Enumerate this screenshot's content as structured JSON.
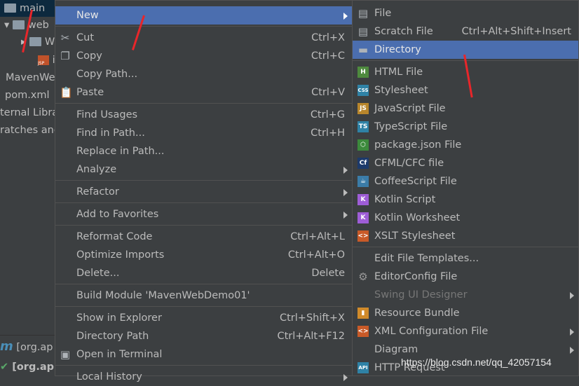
{
  "project_tree": {
    "items": [
      "main",
      "web",
      "W",
      "i",
      "MavenWe",
      "pom.xml",
      "ternal Libra",
      "ratches and"
    ],
    "bottom": [
      "[org.ap",
      "[org.ap"
    ]
  },
  "main_menu": [
    {
      "label": "New",
      "submenu": true,
      "highlighted": true
    },
    {
      "sep": true
    },
    {
      "label": "Cut",
      "shortcut": "Ctrl+X",
      "icon": "scissors-icon"
    },
    {
      "label": "Copy",
      "shortcut": "Ctrl+C",
      "icon": "copy-icon"
    },
    {
      "label": "Copy Path..."
    },
    {
      "label": "Paste",
      "shortcut": "Ctrl+V",
      "icon": "clipboard-icon"
    },
    {
      "sep": true
    },
    {
      "label": "Find Usages",
      "shortcut": "Ctrl+G"
    },
    {
      "label": "Find in Path...",
      "shortcut": "Ctrl+H"
    },
    {
      "label": "Replace in Path..."
    },
    {
      "label": "Analyze",
      "submenu": true
    },
    {
      "sep": true
    },
    {
      "label": "Refactor",
      "submenu": true
    },
    {
      "sep": true
    },
    {
      "label": "Add to Favorites",
      "submenu": true
    },
    {
      "sep": true
    },
    {
      "label": "Reformat Code",
      "shortcut": "Ctrl+Alt+L"
    },
    {
      "label": "Optimize Imports",
      "shortcut": "Ctrl+Alt+O"
    },
    {
      "label": "Delete...",
      "shortcut": "Delete"
    },
    {
      "sep": true
    },
    {
      "label": "Build Module 'MavenWebDemo01'"
    },
    {
      "sep": true
    },
    {
      "label": "Show in Explorer",
      "shortcut": "Ctrl+Shift+X"
    },
    {
      "label": "Directory Path",
      "shortcut": "Ctrl+Alt+F12"
    },
    {
      "label": "Open in Terminal",
      "icon": "terminal-icon"
    },
    {
      "sep": true
    },
    {
      "label": "Local History",
      "submenu": true
    }
  ],
  "new_submenu": [
    {
      "label": "File",
      "icon": "file-icon"
    },
    {
      "label": "Scratch File",
      "shortcut": "Ctrl+Alt+Shift+Insert",
      "icon": "scratch-file-icon"
    },
    {
      "label": "Directory",
      "icon": "folder-icon",
      "highlighted": true
    },
    {
      "sep": true
    },
    {
      "label": "HTML File",
      "icon": "html-file-icon",
      "badge": "H",
      "color": "#4e8a3e"
    },
    {
      "label": "Stylesheet",
      "icon": "css-file-icon",
      "badge": "CSS",
      "color": "#2f82a6"
    },
    {
      "label": "JavaScript File",
      "icon": "js-file-icon",
      "badge": "JS",
      "color": "#b8862c"
    },
    {
      "label": "TypeScript File",
      "icon": "ts-file-icon",
      "badge": "TS",
      "color": "#2f82a6"
    },
    {
      "label": "package.json File",
      "icon": "nodejs-icon",
      "badge": "⬡",
      "color": "#3c8a3c"
    },
    {
      "label": "CFML/CFC file",
      "icon": "cfml-icon",
      "badge": "Cf",
      "color": "#1d3a6b"
    },
    {
      "label": "CoffeeScript File",
      "icon": "coffeescript-icon",
      "badge": "☕",
      "color": "#3b7ca8"
    },
    {
      "label": "Kotlin Script",
      "icon": "kotlin-icon",
      "badge": "K",
      "color": "#9e5dd6"
    },
    {
      "label": "Kotlin Worksheet",
      "icon": "kotlin-worksheet-icon",
      "badge": "K",
      "color": "#9e5dd6"
    },
    {
      "label": "XSLT Stylesheet",
      "icon": "xslt-icon",
      "badge": "<>",
      "color": "#c85a28"
    },
    {
      "sep": true
    },
    {
      "label": "Edit File Templates..."
    },
    {
      "label": "EditorConfig File",
      "icon": "gear-icon",
      "badge": "⚙",
      "color": "transparent"
    },
    {
      "label": "Swing UI Designer",
      "submenu": true,
      "disabled": true
    },
    {
      "label": "Resource Bundle",
      "icon": "resource-bundle-icon",
      "badge": "▮",
      "color": "#d08a2a"
    },
    {
      "label": "XML Configuration File",
      "submenu": true,
      "icon": "xml-file-icon",
      "badge": "<>",
      "color": "#c85a28"
    },
    {
      "label": "Diagram",
      "submenu": true
    },
    {
      "label": "HTTP Request",
      "icon": "api-icon",
      "badge": "API",
      "color": "#2f82a6"
    }
  ],
  "watermark": "https://blog.csdn.net/qq_42057154",
  "colors": {
    "highlight": "#4b6eaf",
    "background": "#3c3f41",
    "annotation_arrow": "#e8262a"
  }
}
